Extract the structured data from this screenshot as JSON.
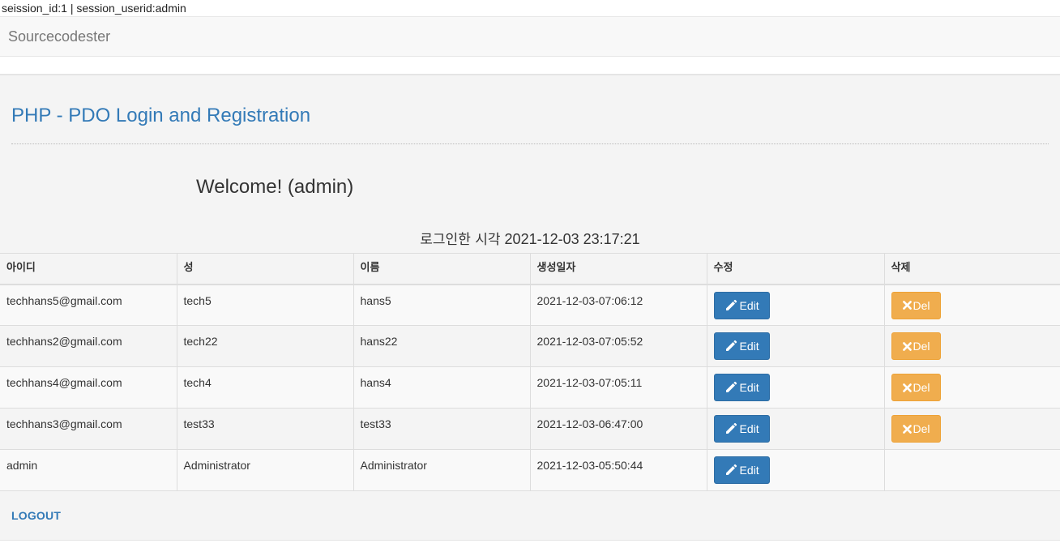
{
  "session": {
    "text": "seission_id:1 | session_userid:admin"
  },
  "navbar": {
    "brand": "Sourcecodester"
  },
  "page": {
    "title": "PHP - PDO Login and Registration",
    "welcome": "Welcome! (admin)",
    "login_time_label": "로그인한 시각",
    "login_time_value": "2021-12-03 23:17:21",
    "logout": "LOGOUT"
  },
  "table": {
    "headers": [
      "아이디",
      "성",
      "이름",
      "생성일자",
      "수정",
      "삭제"
    ],
    "rows": [
      {
        "id": "techhans5@gmail.com",
        "last": "tech5",
        "first": "hans5",
        "created": "2021-12-03-07:06:12",
        "edit": "Edit",
        "del": "Del"
      },
      {
        "id": "techhans2@gmail.com",
        "last": "tech22",
        "first": "hans22",
        "created": "2021-12-03-07:05:52",
        "edit": "Edit",
        "del": "Del"
      },
      {
        "id": "techhans4@gmail.com",
        "last": "tech4",
        "first": "hans4",
        "created": "2021-12-03-07:05:11",
        "edit": "Edit",
        "del": "Del"
      },
      {
        "id": "techhans3@gmail.com",
        "last": "test33",
        "first": "test33",
        "created": "2021-12-03-06:47:00",
        "edit": "Edit",
        "del": "Del"
      },
      {
        "id": "admin",
        "last": "Administrator",
        "first": "Administrator",
        "created": "2021-12-03-05:50:44",
        "edit": "Edit"
      }
    ]
  },
  "icons": {
    "edit": "pencil-icon",
    "delete": "remove-x-icon"
  },
  "colors": {
    "primary": "#337ab7",
    "warning": "#f0ad4e"
  }
}
